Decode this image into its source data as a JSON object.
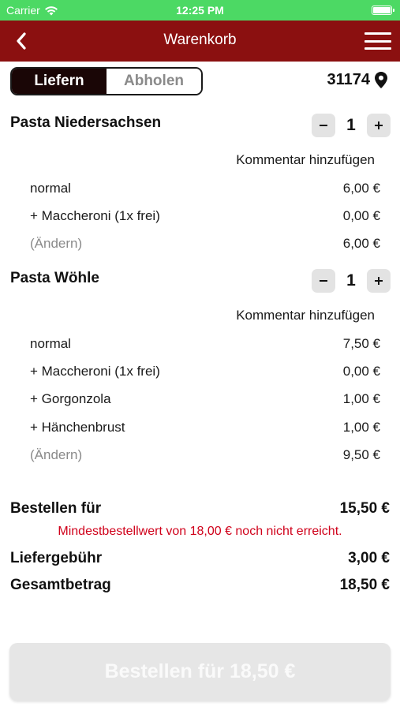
{
  "status": {
    "carrier": "Carrier",
    "time": "12:25 PM"
  },
  "nav": {
    "title": "Warenkorb"
  },
  "segment": {
    "deliver": "Liefern",
    "pickup": "Abholen"
  },
  "postcode": "31174",
  "items": [
    {
      "name": "Pasta Niedersachsen",
      "qty": "1",
      "comment": "Kommentar hinzufügen",
      "lines": [
        {
          "label": "normal",
          "price": "6,00 €"
        },
        {
          "label": "+ Maccheroni (1x frei)",
          "price": "0,00 €"
        },
        {
          "label": "(Ändern)",
          "price": "6,00 €"
        }
      ]
    },
    {
      "name": "Pasta Wöhle",
      "qty": "1",
      "comment": "Kommentar hinzufügen",
      "lines": [
        {
          "label": "normal",
          "price": "7,50 €"
        },
        {
          "label": "+ Maccheroni (1x frei)",
          "price": "0,00 €"
        },
        {
          "label": "+ Gorgonzola",
          "price": "1,00 €"
        },
        {
          "label": "+ Hänchenbrust",
          "price": "1,00 €"
        },
        {
          "label": "(Ändern)",
          "price": "9,50 €"
        }
      ]
    }
  ],
  "totals": {
    "subtotal_label": "Bestellen für",
    "subtotal_value": "15,50 €",
    "warning": "Mindestbestellwert von 18,00 € noch nicht erreicht.",
    "fee_label": "Liefergebühr",
    "fee_value": "3,00 €",
    "total_label": "Gesamtbetrag",
    "total_value": "18,50 €"
  },
  "order_button": "Bestellen für 18,50 €",
  "colors": {
    "status_bar": "#4cd964",
    "nav_bar": "#8b1010",
    "warning": "#d0021b"
  }
}
